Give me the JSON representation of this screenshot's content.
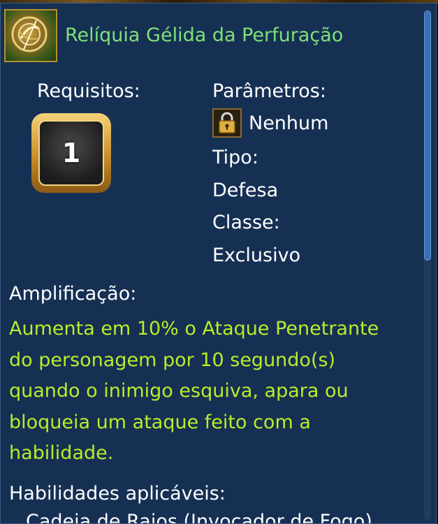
{
  "item": {
    "title": "Relíquia Gélida da Perfuração",
    "icon": "frozen-relic-icon"
  },
  "requirements": {
    "label": "Requisitos:",
    "level": "1"
  },
  "parameters": {
    "label": "Parâmetros:",
    "lock_icon": "lock-icon",
    "lock_value": "Nenhum",
    "type_label": "Tipo:",
    "type_value": "Defesa",
    "class_label": "Classe:",
    "class_value": "Exclusivo"
  },
  "amplification": {
    "label": "Amplificação:",
    "lines": [
      "Aumenta em 10% o Ataque Penetrante",
      "do personagem por 10 segundo(s)",
      "quando o inimigo esquiva, apara ou",
      "bloqueia um ataque feito com a",
      "habilidade."
    ]
  },
  "applicable_skills": {
    "label": "Habilidades aplicáveis:",
    "first_item": "Cadeia de Raios (Invocador de Fogo)"
  },
  "scrollbar": {
    "position": 0.0,
    "visible_fraction": 0.49
  },
  "colors": {
    "panel_bg": "#163054",
    "title_green": "#7fe07a",
    "desc_green": "#b8ee2a",
    "text_white": "#ffffff",
    "gold": "#c78d2a"
  }
}
